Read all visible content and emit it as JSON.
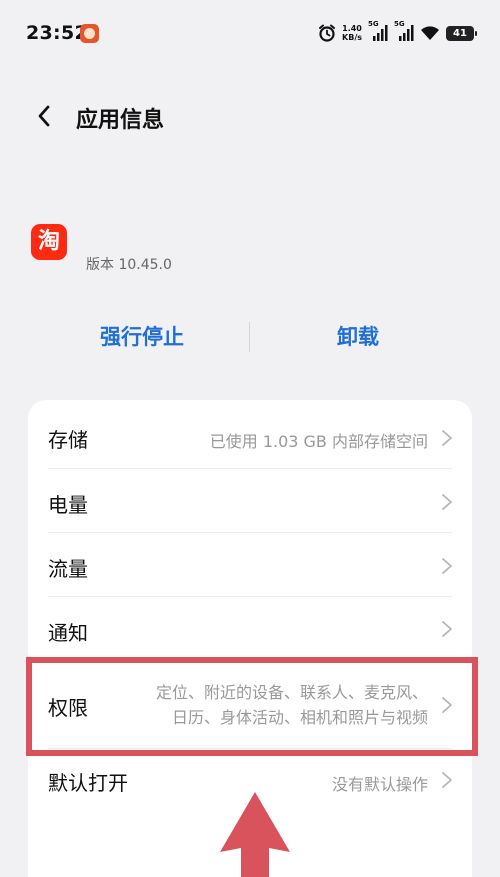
{
  "status_bar": {
    "time": "23:52",
    "net_speed_value": "1.40",
    "net_speed_unit": "KB/s",
    "signal_1_label": "5G",
    "signal_2_label": "5G",
    "battery_level": "41",
    "icons": [
      "alarm-icon",
      "signal-icon",
      "signal-icon",
      "wifi-icon",
      "battery-icon"
    ]
  },
  "header": {
    "title": "应用信息"
  },
  "app": {
    "icon_glyph": "淘",
    "version": "版本 10.45.0"
  },
  "actions": {
    "force_stop_label": "强行停止",
    "uninstall_label": "卸载"
  },
  "settings": {
    "items": [
      {
        "label": "存储",
        "value": "已使用 1.03 GB 内部存储空间"
      },
      {
        "label": "电量",
        "value": ""
      },
      {
        "label": "流量",
        "value": ""
      },
      {
        "label": "通知",
        "value": ""
      },
      {
        "label": "权限",
        "value_line1": "定位、附近的设备、联系人、麦克风、",
        "value_line2": "日历、身体活动、相机和照片与视频"
      },
      {
        "label": "默认打开",
        "value": "没有默认操作"
      }
    ]
  },
  "colors": {
    "accent": "#1f6fd6",
    "background": "#f1f1f3",
    "card": "#ffffff",
    "highlight": "#d9535c",
    "app_icon": "#ff2a12"
  }
}
